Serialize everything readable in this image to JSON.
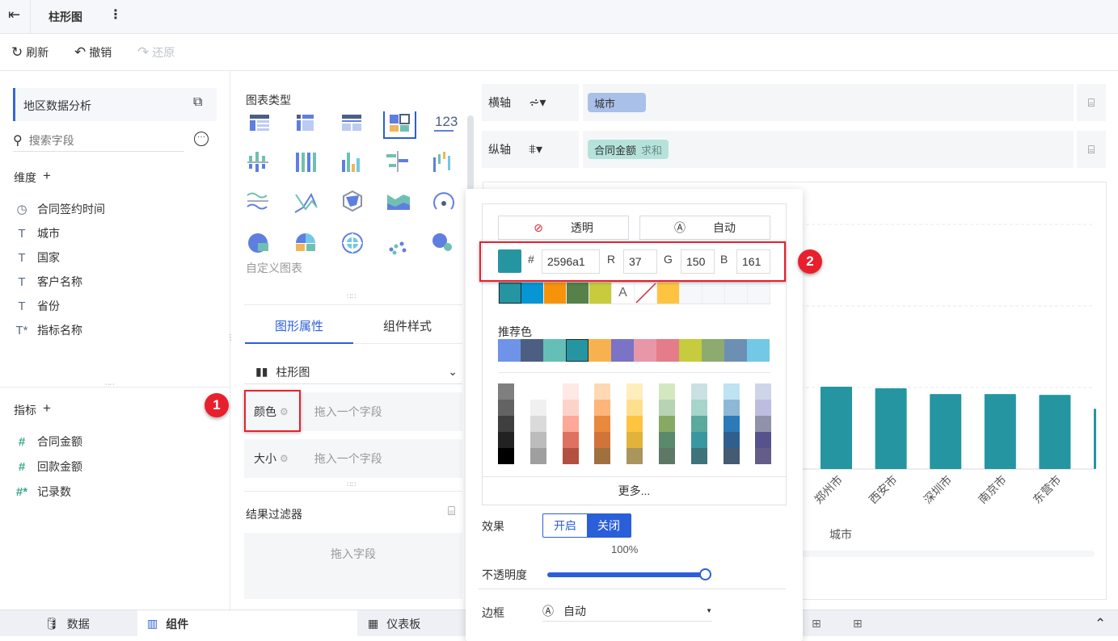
{
  "header": {
    "title": "柱形图",
    "back_icon": "exit-icon",
    "more_icon": "kebab-icon"
  },
  "toolbar": {
    "refresh": "刷新",
    "undo": "撤销",
    "redo": "还原"
  },
  "left": {
    "dataset": "地区数据分析",
    "search_placeholder": "搜索字段",
    "dimensions_label": "维度",
    "dimensions": [
      {
        "label": "合同签约时间",
        "icon": "clock"
      },
      {
        "label": "城市",
        "icon": "T"
      },
      {
        "label": "国家",
        "icon": "T"
      },
      {
        "label": "客户名称",
        "icon": "T"
      },
      {
        "label": "省份",
        "icon": "T"
      },
      {
        "label": "指标名称",
        "icon": "T*"
      }
    ],
    "measures_label": "指标",
    "measures": [
      {
        "label": "合同金额",
        "icon": "#"
      },
      {
        "label": "回款金额",
        "icon": "#"
      },
      {
        "label": "记录数",
        "icon": "#*"
      }
    ]
  },
  "middle": {
    "chart_type_label": "图表类型",
    "number_icon_label": "123",
    "custom_chart": "自定义图表",
    "tabs": [
      "图形属性",
      "组件样式"
    ],
    "chart_select": "柱形图",
    "color_label": "颜色",
    "color_drop": "拖入一个字段",
    "size_label": "大小",
    "size_drop": "拖入一个字段",
    "filter_label": "结果过滤器",
    "filter_drop": "拖入字段"
  },
  "axes": {
    "x_label": "横轴",
    "x_field": "城市",
    "y_label": "纵轴",
    "y_field": "合同金额",
    "y_agg": "求和"
  },
  "chart_data": {
    "type": "bar",
    "categories": [
      "郑州市",
      "西安市",
      "深圳市",
      "南京市",
      "东营市",
      ""
    ],
    "values": [
      1.01,
      0.99,
      0.92,
      0.92,
      0.91,
      0.74
    ],
    "xlabel": "城市",
    "ylabel": "",
    "ylim": [
      0,
      3
    ],
    "grid": true,
    "color": "#2596a1"
  },
  "color_picker": {
    "transparent": "透明",
    "auto": "自动",
    "hash": "#",
    "hex": "2596a1",
    "r_label": "R",
    "r": "37",
    "g_label": "G",
    "g": "150",
    "b_label": "B",
    "b": "161",
    "recent": [
      "#2596a1",
      "#0796d4",
      "#f7930a",
      "#568149",
      "#c8cc3c",
      "A",
      "none",
      "#fec43f",
      "#f5f7fa",
      "#f5f7fa",
      "#f5f7fa",
      "#f5f7fa"
    ],
    "recommended_label": "推荐色",
    "recommended": [
      "#6f93e8",
      "#4c5f82",
      "#66bfb6",
      "#2596a1",
      "#f7b24f",
      "#7b73c5",
      "#e897a8",
      "#e57c8a",
      "#c6cc3d",
      "#8dab70",
      "#6e8fb4",
      "#73c8e5"
    ],
    "palette": [
      [
        "#7f7f7f",
        "#636363",
        "#3f3f3f",
        "#222222",
        "#000000"
      ],
      [
        "#ffffff",
        "#f0f0f0",
        "#dadada",
        "#bcbcbc",
        "#9f9f9f"
      ],
      [
        "#fde9e6",
        "#fdd3c9",
        "#fda898",
        "#df7160",
        "#b25041"
      ],
      [
        "#fed9b4",
        "#fdb57a",
        "#e9893d",
        "#d0743a",
        "#a0713e"
      ],
      [
        "#fdeebb",
        "#fddf8e",
        "#fec43f",
        "#e2b33b",
        "#aa955c"
      ],
      [
        "#d4e8c0",
        "#b8d3b4",
        "#88a964",
        "#5a896c",
        "#5e7866"
      ],
      [
        "#c9e1e3",
        "#a7d4cb",
        "#5baa9d",
        "#3a979f",
        "#3e737b"
      ],
      [
        "#bee3f2",
        "#8eb9d6",
        "#2c7ab8",
        "#305f8f",
        "#455a73"
      ],
      [
        "#cdd5e8",
        "#bdbde0",
        "#9092a9",
        "#56528c",
        "#645d87"
      ]
    ],
    "more": "更多...",
    "effect_label": "效果",
    "effect_on": "开启",
    "effect_off": "关闭",
    "opacity_value": "100%",
    "opacity_label": "不透明度",
    "opacity": 1.0,
    "border_label": "边框",
    "border_value": "自动"
  },
  "annotations": {
    "one": "1",
    "two": "2"
  },
  "bottom": {
    "data": "数据",
    "component": "组件",
    "dashboard": "仪表板"
  }
}
